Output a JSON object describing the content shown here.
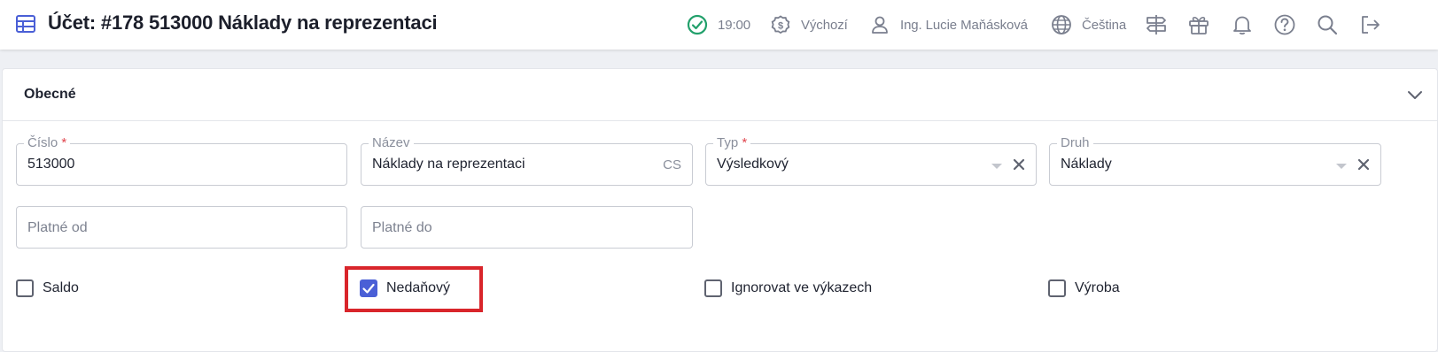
{
  "header": {
    "title": "Účet: #178 513000 Náklady na reprezentaci",
    "time": "19:00",
    "currency_profile": "Výchozí",
    "user": "Ing. Lucie Maňásková",
    "language": "Čeština",
    "icons": [
      "table-icon",
      "check-circle-icon",
      "dollar-circle-icon",
      "user-icon",
      "globe-icon",
      "signpost-icon",
      "gift-icon",
      "bell-icon",
      "help-icon",
      "search-icon",
      "logout-icon"
    ]
  },
  "section": {
    "title": "Obecné"
  },
  "fields": {
    "cislo": {
      "label": "Číslo",
      "required_mark": "*",
      "value": "513000"
    },
    "nazev": {
      "label": "Název",
      "value": "Náklady na reprezentaci",
      "lang": "CS"
    },
    "typ": {
      "label": "Typ",
      "required_mark": "*",
      "value": "Výsledkový"
    },
    "druh": {
      "label": "Druh",
      "value": "Náklady"
    },
    "platne_od": {
      "placeholder": "Platné od"
    },
    "platne_do": {
      "placeholder": "Platné do"
    }
  },
  "checkboxes": {
    "saldo": {
      "label": "Saldo",
      "checked": false
    },
    "nedanovy": {
      "label": "Nedaňový",
      "checked": true
    },
    "ignorovat": {
      "label": "Ignorovat ve výkazech",
      "checked": false
    },
    "vyroba": {
      "label": "Výroba",
      "checked": false
    }
  },
  "colors": {
    "accent": "#4a5fd6",
    "highlight": "#d9252b",
    "success": "#22a06b",
    "required": "#e0454d"
  }
}
